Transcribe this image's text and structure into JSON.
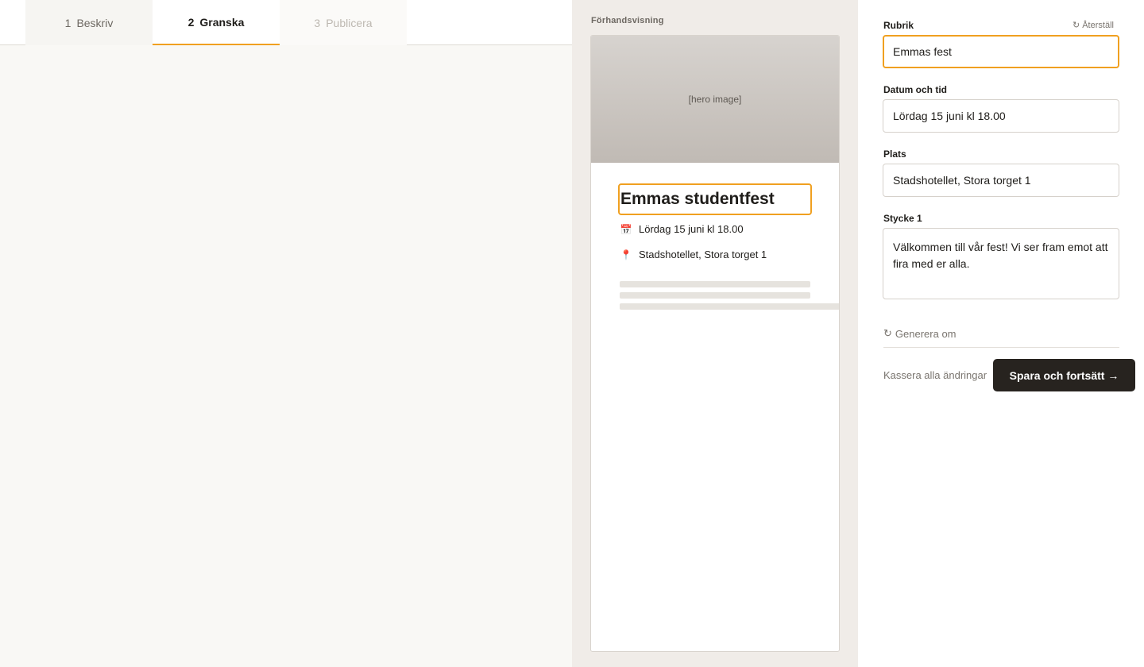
{
  "tabs": [
    {
      "num": "1",
      "label": "Beskriv"
    },
    {
      "num": "2",
      "label": "Granska"
    },
    {
      "num": "3",
      "label": "Publicera"
    }
  ],
  "preview": {
    "label": "Förhandsvisning",
    "hero_placeholder": "[hero image]",
    "title": "Emmas studentfest",
    "date": "Lördag 15 juni kl 18.00",
    "place": "Stadshotellet, Stora torget 1",
    "date_icon": "calendar-icon",
    "place_icon": "pin-icon"
  },
  "form": {
    "reset_label": "Återställ",
    "fields": {
      "rubrik": {
        "label": "Rubrik",
        "value": "Emmas fest"
      },
      "datum": {
        "label": "Datum och tid",
        "value": "Lördag 15 juni kl 18.00"
      },
      "plats": {
        "label": "Plats",
        "value": "Stadshotellet, Stora torget 1"
      },
      "stycke": {
        "label": "Stycke 1",
        "value": "Välkommen till vår fest! Vi ser fram emot att fira med er alla."
      }
    },
    "regenerate_label": "Generera om",
    "discard_label": "Kassera alla ändringar",
    "save_label": "Spara och fortsätt →"
  },
  "colors": {
    "accent": "#f0a020",
    "dark_button": "#27231f"
  }
}
